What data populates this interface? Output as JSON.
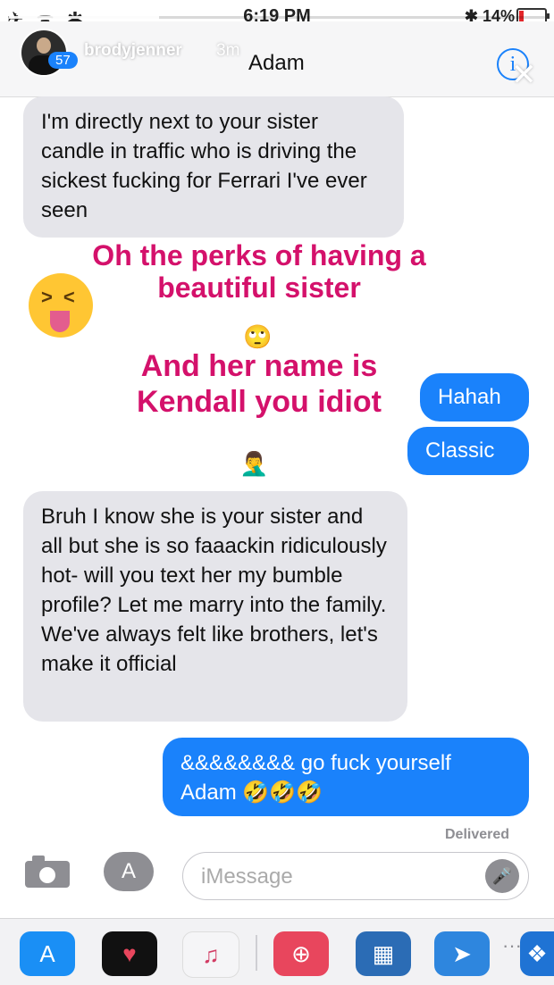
{
  "status_bar": {
    "left_icons": "✈ ᯤ ✱",
    "time": "6:19 PM",
    "battery_text": "✱ 14%",
    "battery_level": 0.14
  },
  "story": {
    "username": "brodyjenner",
    "age": "3m",
    "badge": "57",
    "progress": 0.28
  },
  "header": {
    "contact_name": "Adam",
    "info_icon": "info-icon"
  },
  "messages": {
    "m1": "I'm directly next to your sister candle in traffic who is driving the sickest fucking for Ferrari I've ever seen",
    "s1": "Hahah",
    "s2": "Classic",
    "m2": "Bruh I know she is your sister and all but she is so faaackin ridiculously hot- will you text her my bumble profile? Let me marry into the family. We've always felt like brothers, let's make it official",
    "s3": "&&&&&&&& go fuck yourself Adam 🤣🤣🤣"
  },
  "overlays": {
    "caption1": "Oh the perks of having a beautiful sister",
    "caption2": "And her name is Kendall you idiot",
    "emoji_eyeroll": "🙄",
    "emoji_facepalm": "🤦‍♂️"
  },
  "delivered": "Delivered",
  "compose": {
    "placeholder": "iMessage"
  },
  "tray": {
    "apps": [
      "app-store-icon",
      "heart-app-icon",
      "music-icon",
      "search-app-icon",
      "game-app-icon",
      "browser-app-icon",
      "dropbox-icon"
    ],
    "more": "···"
  },
  "colors": {
    "sent_bubble": "#1a82fb",
    "received_bubble": "#e5e5ea",
    "caption": "#d4116b"
  }
}
